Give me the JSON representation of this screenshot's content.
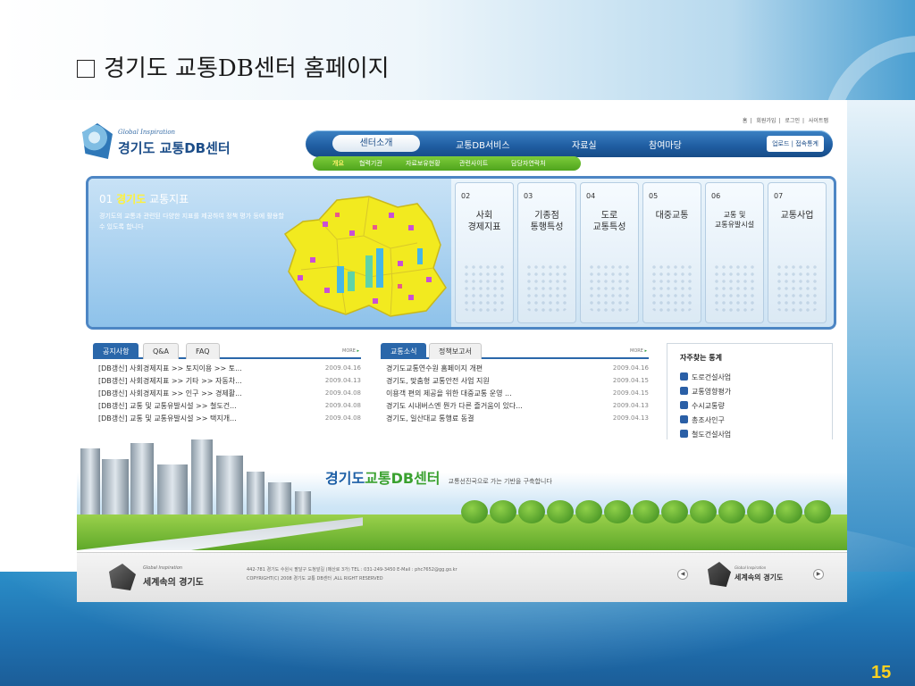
{
  "slide": {
    "title": "경기도 교통DB센터 홈페이지",
    "page_number": "15"
  },
  "site": {
    "util_links": [
      "홈",
      "회원가입",
      "로그인",
      "사이트맵"
    ],
    "logo_tagline": "Global Inspiration",
    "logo_name": "경기도 교통DB센터",
    "main_nav": {
      "active": "센터소개",
      "items": [
        "교통DB서비스",
        "자료실",
        "참여마당"
      ],
      "right_buttons": "업로드 | 접속통계"
    },
    "sub_nav": [
      "개요",
      "협력기관",
      "자료보유현황",
      "관련사이트",
      "담당자연락처"
    ],
    "banner": {
      "number": "01",
      "highlight": "경기도",
      "heading": "교통지표",
      "description": "경기도의 교통과 관련된 다양한 지표를 제공하여 정책 평가 등에 활용할 수 있도록 합니다",
      "tiles": [
        {
          "num": "02",
          "label": "사회\n경제지표"
        },
        {
          "num": "03",
          "label": "기종점\n통행특성"
        },
        {
          "num": "04",
          "label": "도로\n교통특성"
        },
        {
          "num": "05",
          "label": "대중교통"
        },
        {
          "num": "06",
          "label": "교통 및\n교통유발시설"
        },
        {
          "num": "07",
          "label": "교통사업"
        }
      ]
    },
    "notice_board": {
      "tabs": [
        "공지사항",
        "Q&A",
        "FAQ"
      ],
      "more": "MORE",
      "rows": [
        {
          "title": "[DB갱신] 사회경제지표 >> 토지이용 >> 토...",
          "date": "2009.04.16"
        },
        {
          "title": "[DB갱신] 사회경제지표 >> 기타 >> 자동차...",
          "date": "2009.04.13"
        },
        {
          "title": "[DB갱신] 사회경제지표 >> 인구 >> 경제활...",
          "date": "2009.04.08"
        },
        {
          "title": "[DB갱신] 교통 및 교통유발시설 >> 철도건...",
          "date": "2009.04.08"
        },
        {
          "title": "[DB갱신] 교통 및 교통유발시설 >> 택지개...",
          "date": "2009.04.08"
        }
      ]
    },
    "news_board": {
      "tabs": [
        "교통소식",
        "정책보고서"
      ],
      "more": "MORE",
      "rows": [
        {
          "title": "경기도교통연수원 홈페이지 개편",
          "date": "2009.04.16"
        },
        {
          "title": "경기도, 맞춤형 교통안전 사업 지원",
          "date": "2009.04.15"
        },
        {
          "title": "이용객 편의 제공을 위한 대중교통 운영 ...",
          "date": "2009.04.15"
        },
        {
          "title": "경기도 시내버스엔 뭔가 다른 즐거움이 있다...",
          "date": "2009.04.13"
        },
        {
          "title": "경기도, 일산대교 통행료 동결",
          "date": "2009.04.13"
        }
      ]
    },
    "favorites": {
      "title": "자주찾는 통계",
      "items": [
        "도로건설사업",
        "교통영향평가",
        "수시교통량",
        "총조사인구",
        "철도건설사업"
      ]
    },
    "slogan": {
      "prefix": "경기도",
      "brand": "교통DB센터",
      "tail": "교통선진국으로 가는 기반을 구축합니다"
    },
    "footer": {
      "tagline": "Global Inspiration",
      "name": "세계속의 경기도",
      "address": "442-781 경기도 수원시 팔달구 도청앞길 (매산로 3가)  TEL : 031-249-3450  E-Mail : phc7652@gg.go.kr",
      "copyright": "COPYRIGHT(C) 2008 경기도 교통 DB센터 ,ALL RIGHT RESERVED",
      "prev": "◀",
      "next": "▶",
      "right_tagline": "Global Inspiration",
      "right_name": "세계속의 경기도"
    }
  },
  "colors": {
    "nav_blue": "#1f5da1",
    "sub_nav_green": "#4fa41d",
    "page_number": "#ffd21f",
    "map_yellow": "#f2ea1f"
  }
}
